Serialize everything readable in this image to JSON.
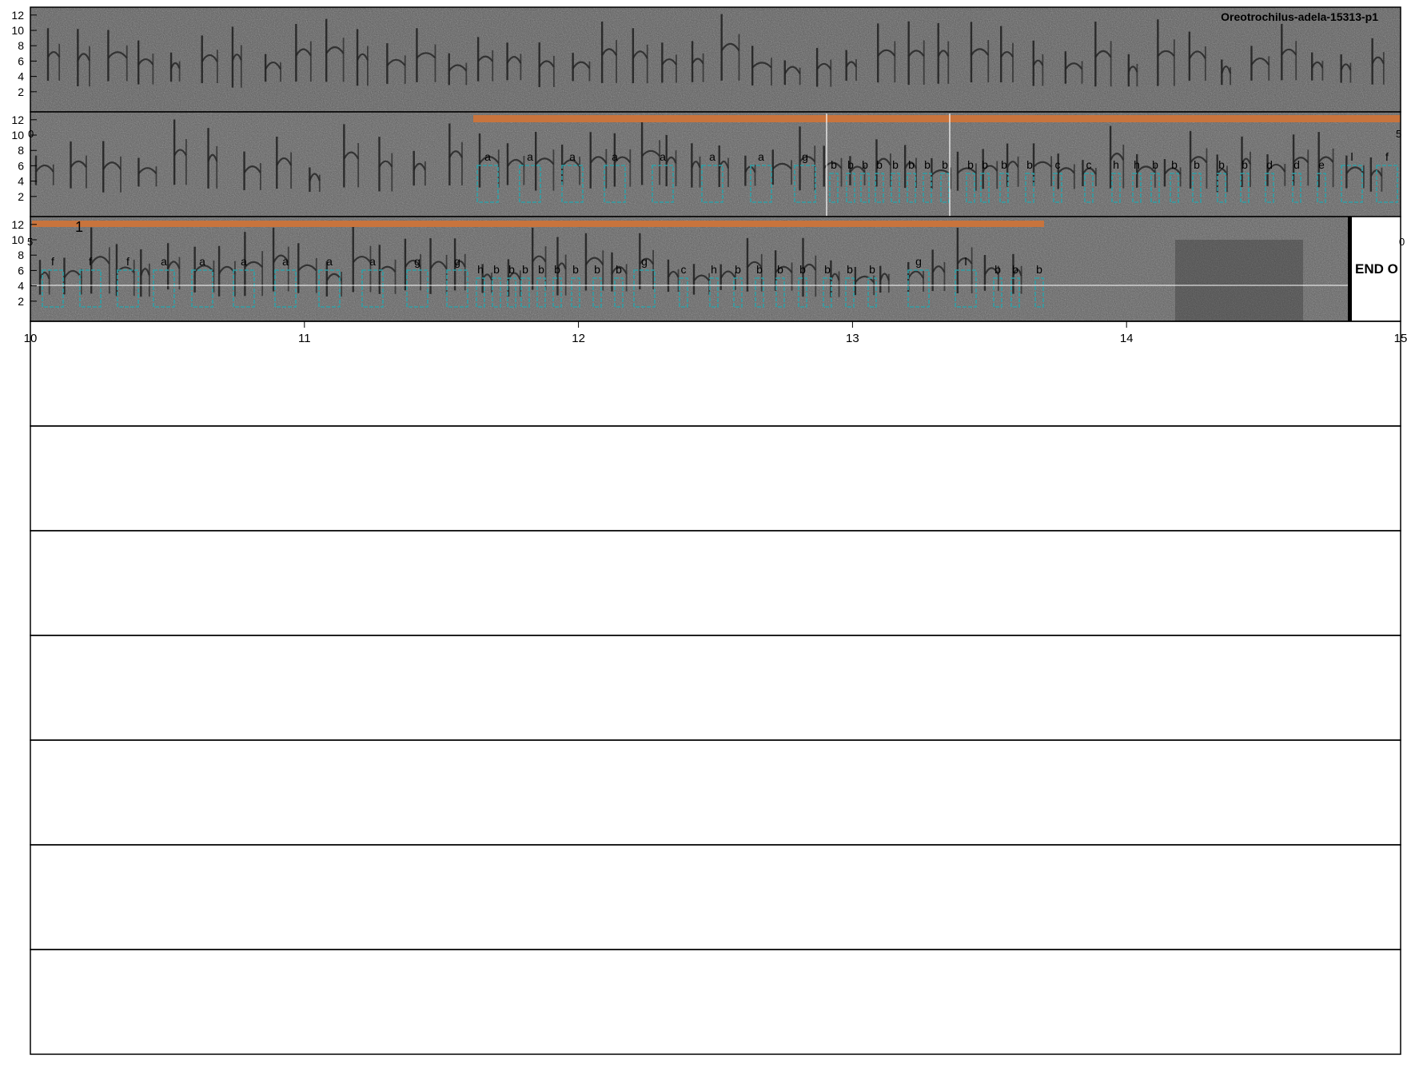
{
  "title": "Oreotrochilus-adela-15313-p1",
  "end_label": "END O",
  "marker_label": "1",
  "y_ticks": [
    "2",
    "4",
    "6",
    "8",
    "10",
    "12"
  ],
  "time_ticks": [
    "10",
    "11",
    "12",
    "13",
    "14",
    "15"
  ],
  "edge_fragments": {
    "row2_left": "0",
    "row2_right": "5",
    "row3_left": "5",
    "row3_right": "0"
  },
  "colors": {
    "spectrogram_bg": "#5e5e5e",
    "annotation_box": "#2f9fa6",
    "selection_bar": "#c8743d",
    "ink": "#000000"
  },
  "rows": [
    {
      "id": "row-1",
      "labels": []
    },
    {
      "id": "row-2",
      "labels": [
        "a",
        "a",
        "a",
        "a",
        "a",
        "a",
        "a",
        "g",
        "b",
        "b",
        "b",
        "b",
        "b",
        "b",
        "b",
        "b",
        "b",
        "b",
        "b",
        "b",
        "c",
        "c",
        "h",
        "h",
        "b",
        "b",
        "b",
        "b",
        "b",
        "d",
        "d",
        "e",
        "l",
        "f"
      ]
    },
    {
      "id": "row-3",
      "labels": [
        "f",
        "f",
        "f",
        "a",
        "a",
        "a",
        "a",
        "a",
        "a",
        "g",
        "g",
        "h",
        "b",
        "b",
        "b",
        "b",
        "b",
        "b",
        "b",
        "b",
        "g",
        "c",
        "h",
        "b",
        "b",
        "b",
        "b",
        "b",
        "b",
        "b",
        "g",
        "l",
        "b",
        "b",
        "b"
      ]
    }
  ],
  "empty_panels": 7
}
